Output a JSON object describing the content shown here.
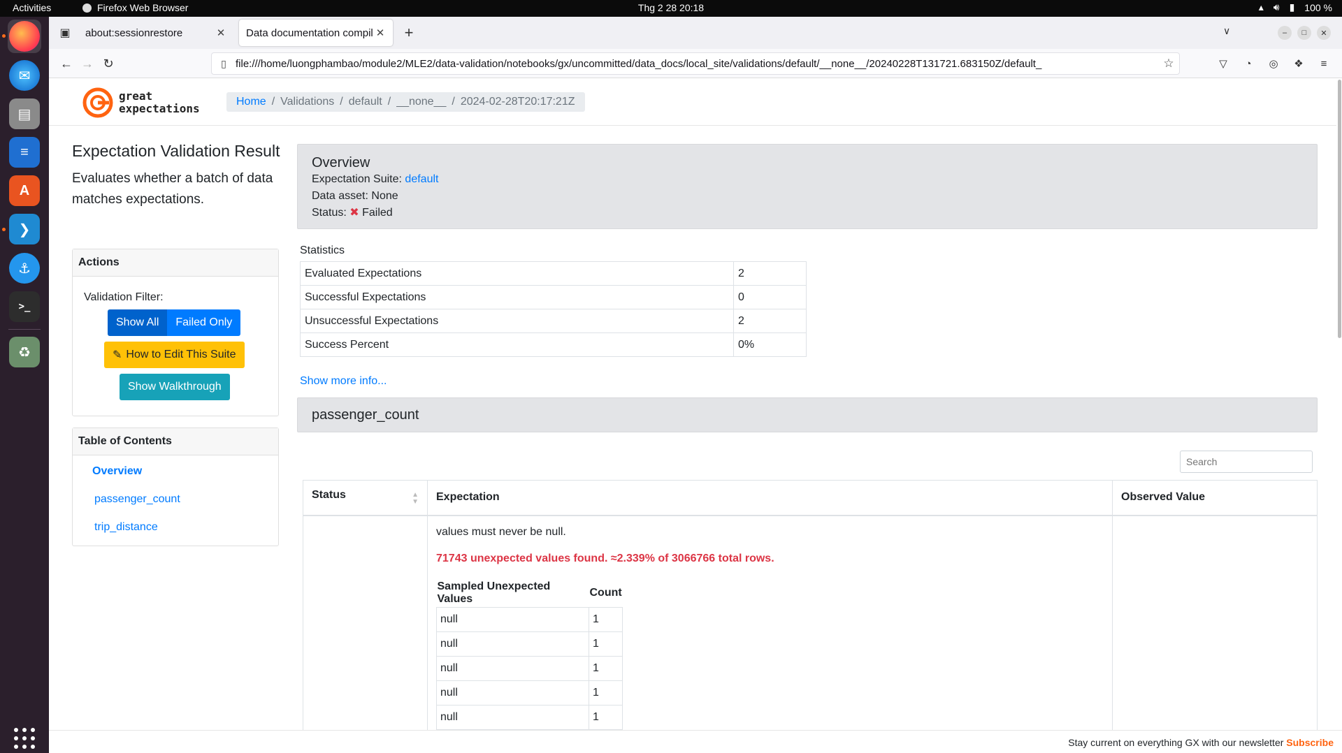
{
  "topbar": {
    "activities": "Activities",
    "app_name": "Firefox Web Browser",
    "clock": "Thg 2 28  20:18",
    "battery": "100 %"
  },
  "browser": {
    "tabs": [
      {
        "title": "about:sessionrestore",
        "active": false
      },
      {
        "title": "Data documentation compil",
        "active": true
      }
    ],
    "url": "file:///home/luongphambao/module2/MLE2/data-validation/notebooks/gx/uncommitted/data_docs/local_site/validations/default/__none__/20240228T131721.683150Z/default_"
  },
  "header": {
    "logo_line1": "great",
    "logo_line2": "expectations",
    "breadcrumb": {
      "home": "Home",
      "crumbs": [
        "Validations",
        "default",
        "__none__",
        "2024-02-28T20:17:21Z"
      ]
    }
  },
  "left": {
    "title": "Expectation Validation Result",
    "lead": "Evaluates whether a batch of data matches expectations.",
    "actions": {
      "header": "Actions",
      "filter_label": "Validation Filter:",
      "show_all": "Show All",
      "failed_only": "Failed Only",
      "edit_suite": "How to Edit This Suite",
      "walkthrough": "Show Walkthrough"
    },
    "toc": {
      "header": "Table of Contents",
      "items": [
        "Overview",
        "passenger_count",
        "trip_distance"
      ]
    }
  },
  "overview": {
    "title": "Overview",
    "suite_label": "Expectation Suite:",
    "suite_value": "default",
    "asset_label": "Data asset:",
    "asset_value": "None",
    "status_label": "Status:",
    "status_value": "Failed"
  },
  "statistics": {
    "title": "Statistics",
    "rows": [
      {
        "label": "Evaluated Expectations",
        "value": "2"
      },
      {
        "label": "Successful Expectations",
        "value": "0"
      },
      {
        "label": "Unsuccessful Expectations",
        "value": "2"
      },
      {
        "label": "Success Percent",
        "value": "0%"
      }
    ],
    "show_more": "Show more info..."
  },
  "section": {
    "title": "passenger_count",
    "search_placeholder": "Search",
    "columns": [
      "Status",
      "Expectation",
      "Observed Value"
    ],
    "expectation_text": "values must never be null.",
    "unexpected_text": "71743 unexpected values found. ≈2.339% of 3066766 total rows.",
    "sample_headers": [
      "Sampled Unexpected Values",
      "Count"
    ],
    "samples": [
      {
        "value": "null",
        "count": "1"
      },
      {
        "value": "null",
        "count": "1"
      },
      {
        "value": "null",
        "count": "1"
      },
      {
        "value": "null",
        "count": "1"
      },
      {
        "value": "null",
        "count": "1"
      }
    ]
  },
  "footer": {
    "text": "Stay current on everything GX with our newsletter",
    "link": "Subscribe"
  },
  "colors": {
    "primary": "#007bff",
    "warning": "#ffc107",
    "info": "#17a2b8",
    "danger": "#dc3545",
    "gx_orange": "#ff6310"
  }
}
